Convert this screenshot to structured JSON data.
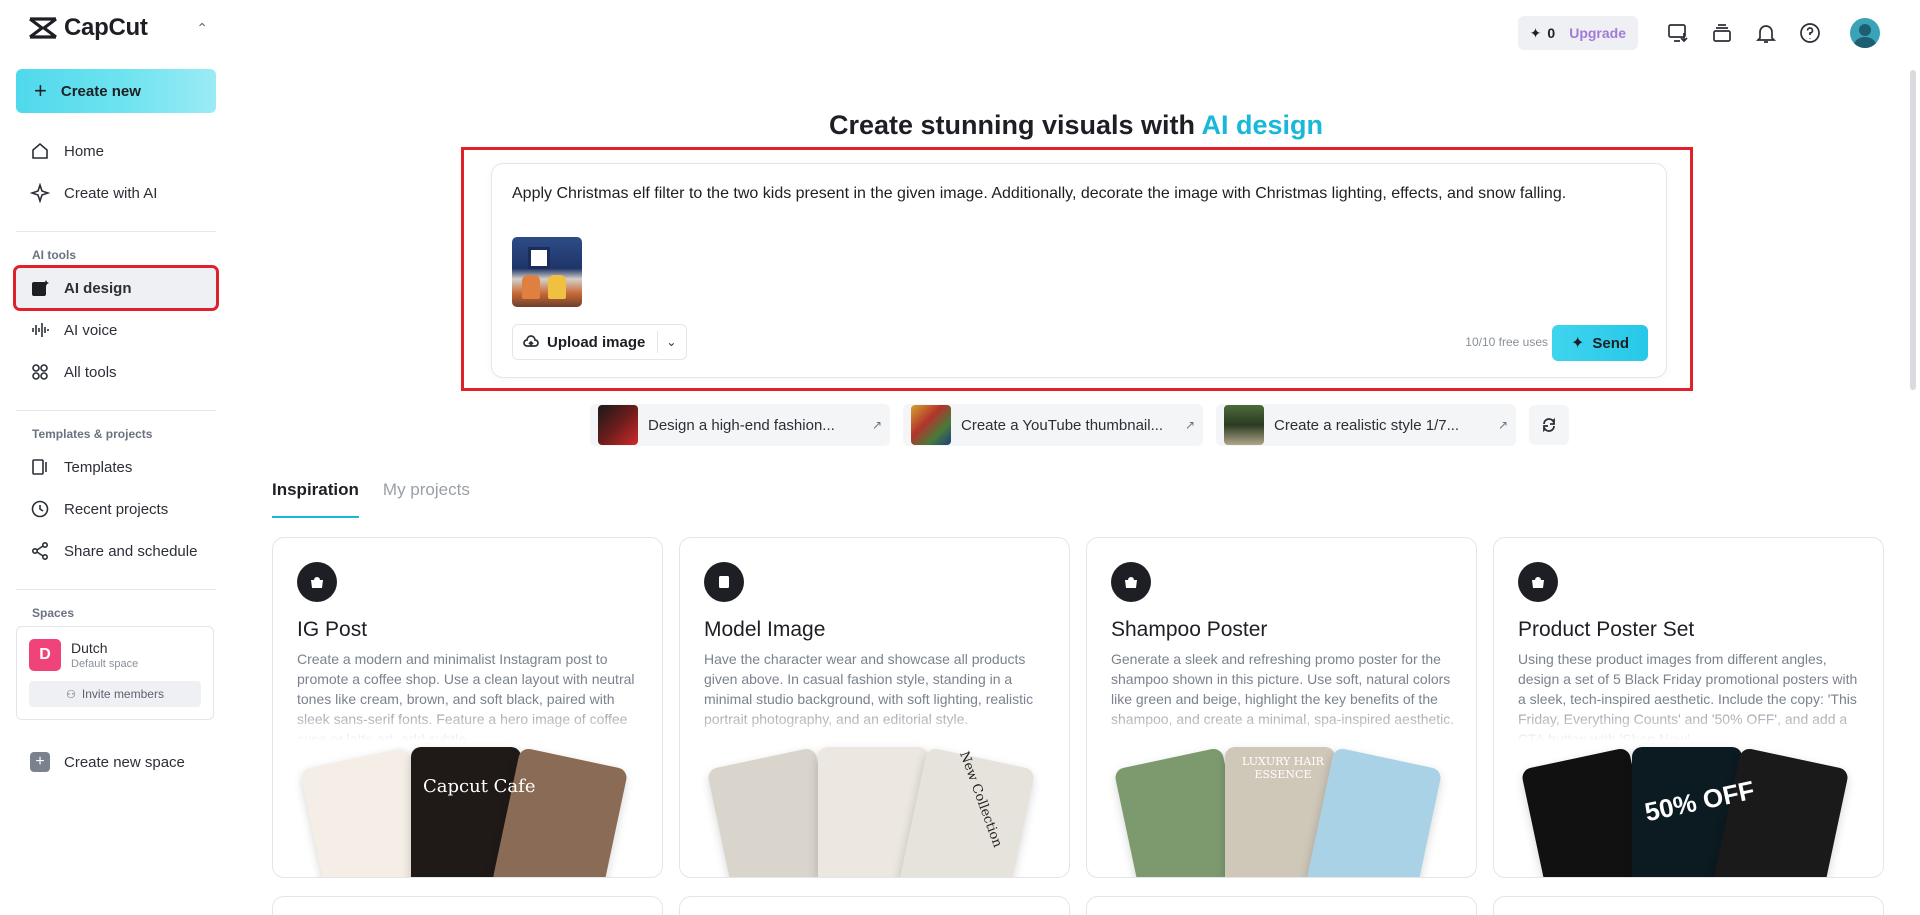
{
  "app": {
    "name": "CapCut",
    "switcher_icon": "chevron-updown-icon"
  },
  "sidebar": {
    "create_label": "Create new",
    "primary": [
      {
        "label": "Home",
        "icon": "home-icon"
      },
      {
        "label": "Create with AI",
        "icon": "sparkle-icon"
      }
    ],
    "ai_tools_label": "AI tools",
    "ai_tools": [
      {
        "label": "AI design",
        "icon": "image-ai-icon",
        "active": true
      },
      {
        "label": "AI voice",
        "icon": "waveform-icon"
      },
      {
        "label": "All tools",
        "icon": "grid-icon"
      }
    ],
    "templates_label": "Templates & projects",
    "templates": [
      {
        "label": "Templates",
        "icon": "template-icon"
      },
      {
        "label": "Recent projects",
        "icon": "clock-icon"
      },
      {
        "label": "Share and schedule",
        "icon": "share-icon"
      }
    ],
    "spaces_label": "Spaces",
    "space": {
      "initial": "D",
      "name": "Dutch",
      "subtitle": "Default space",
      "invite_label": "Invite members"
    },
    "new_space_label": "Create new space"
  },
  "topbar": {
    "credits": "0",
    "upgrade_label": "Upgrade",
    "icons": [
      "monitor-download-icon",
      "stack-icon",
      "bell-icon",
      "help-icon",
      "avatar"
    ]
  },
  "main": {
    "headline_prefix": "Create stunning visuals with ",
    "headline_accent": "AI design",
    "prompt_text": "Apply Christmas elf filter to the two kids present in the given image. Additionally, decorate the image with Christmas lighting, effects, and snow falling.",
    "upload_label": "Upload image",
    "free_uses": "10/10 free uses",
    "send_label": "Send",
    "suggestions": [
      {
        "label": "Design a high-end fashion..."
      },
      {
        "label": "Create a YouTube thumbnail..."
      },
      {
        "label": "Create a realistic style 1/7..."
      }
    ],
    "tabs": [
      {
        "label": "Inspiration",
        "active": true
      },
      {
        "label": "My projects",
        "active": false
      }
    ],
    "cards": [
      {
        "title": "IG Post",
        "desc": "Create a modern and minimalist Instagram post to promote a coffee shop. Use a clean layout with neutral tones like cream, brown, and soft black, paired with sleek sans-serif fonts. Feature a hero image of coffee cups or latte art, add subtle",
        "icon": "bag-icon",
        "art_text": "Capcut Cafe"
      },
      {
        "title": "Model Image",
        "desc": "Have the character wear and showcase all products given above. In casual fashion style, standing in a minimal studio background, with soft lighting, realistic portrait photography, and an editorial style.",
        "icon": "document-icon",
        "art_text": "New Collection"
      },
      {
        "title": "Shampoo Poster",
        "desc": "Generate a sleek and refreshing promo poster for the shampoo shown in this picture. Use soft, natural colors like green and beige, highlight the key benefits of the shampoo, and create a minimal, spa-inspired aesthetic.",
        "icon": "bag-icon",
        "art_text": "LUXURY HAIR ESSENCE"
      },
      {
        "title": "Product Poster Set",
        "desc": "Using these product images from different angles, design a set of 5 Black Friday promotional posters with a sleek, tech-inspired aesthetic. Include the copy: 'This Friday, Everything Counts' and '50% OFF', and add a CTA button with 'Shop Now'.",
        "icon": "bag-icon",
        "art_text": "50% OFF"
      }
    ]
  },
  "colors": {
    "accent": "#19b8d8",
    "upgrade": "#a17bd6",
    "highlight": "#e0202a",
    "space_avatar": "#f0437a"
  }
}
